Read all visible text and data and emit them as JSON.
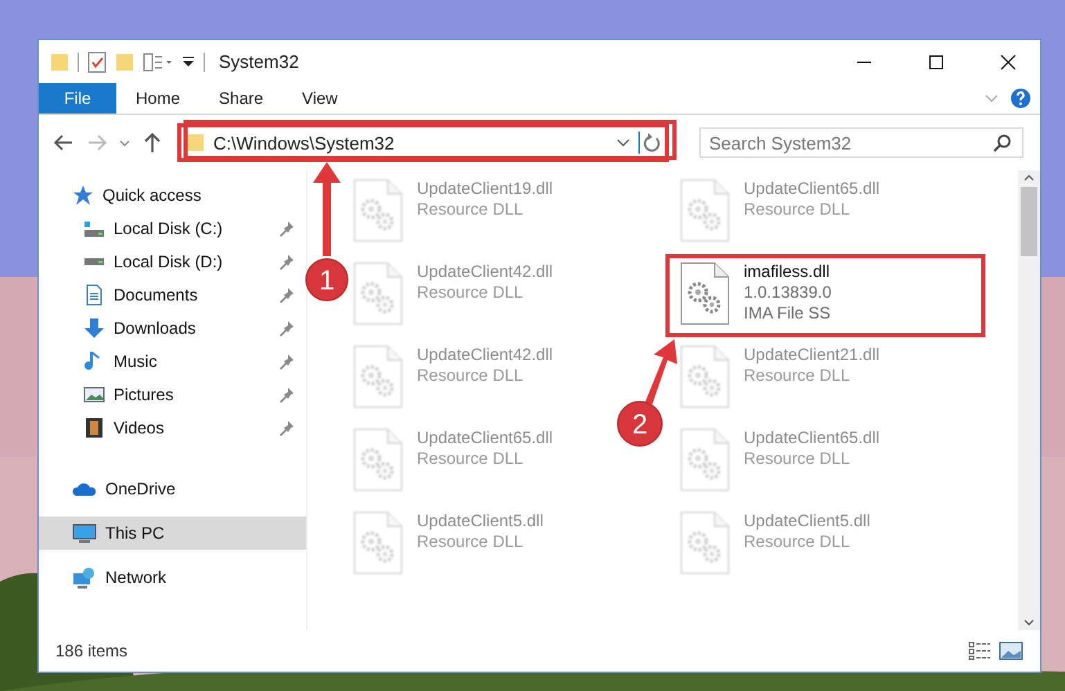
{
  "window": {
    "title": "System32"
  },
  "ribbon_tabs": [
    {
      "label": "File",
      "selected": true
    },
    {
      "label": "Home",
      "selected": false
    },
    {
      "label": "Share",
      "selected": false
    },
    {
      "label": "View",
      "selected": false
    }
  ],
  "address": {
    "path": "C:\\Windows\\System32"
  },
  "search": {
    "placeholder": "Search System32"
  },
  "sidebar": [
    {
      "label": "Quick access",
      "kind": "star",
      "selected": false,
      "children": [
        {
          "label": "Local Disk (C:)",
          "kind": "disk-c",
          "selected": false,
          "pinned": true
        },
        {
          "label": "Local Disk (D:)",
          "kind": "disk",
          "selected": false,
          "pinned": true
        },
        {
          "label": "Documents",
          "kind": "document",
          "selected": false,
          "pinned": true
        },
        {
          "label": "Downloads",
          "kind": "download",
          "selected": false,
          "pinned": true
        },
        {
          "label": "Music",
          "kind": "music",
          "selected": false,
          "pinned": true
        },
        {
          "label": "Pictures",
          "kind": "pictures",
          "selected": false,
          "pinned": true
        },
        {
          "label": "Videos",
          "kind": "film",
          "selected": false,
          "pinned": true
        }
      ]
    },
    {
      "label": "OneDrive",
      "kind": "cloud",
      "selected": false
    },
    {
      "label": "This PC",
      "kind": "monitor",
      "selected": true
    },
    {
      "label": "Network",
      "kind": "network",
      "selected": false
    }
  ],
  "files": [
    {
      "name": "UpdateClient19.dll",
      "lines": [
        "Resource DLL"
      ],
      "blurred": true
    },
    {
      "name": "UpdateClient65.dll",
      "lines": [
        "Resource DLL"
      ],
      "blurred": true
    },
    {
      "name": "UpdateClient42.dll",
      "lines": [
        "Resource DLL"
      ],
      "blurred": true
    },
    {
      "name": "imafiless.dll",
      "lines": [
        "1.0.13839.0",
        "IMA File SS"
      ],
      "blurred": false
    },
    {
      "name": "UpdateClient42.dll",
      "lines": [
        "Resource DLL"
      ],
      "blurred": true
    },
    {
      "name": "UpdateClient21.dll",
      "lines": [
        "Resource DLL"
      ],
      "blurred": true
    },
    {
      "name": "UpdateClient65.dll",
      "lines": [
        "Resource DLL"
      ],
      "blurred": true
    },
    {
      "name": "UpdateClient65.dll",
      "lines": [
        "Resource DLL"
      ],
      "blurred": true
    },
    {
      "name": "UpdateClient5.dll",
      "lines": [
        "Resource DLL"
      ],
      "blurred": true
    },
    {
      "name": "UpdateClient5.dll",
      "lines": [
        "Resource DLL"
      ],
      "blurred": true
    }
  ],
  "status_bar": {
    "count": "186 items"
  },
  "annotations": [
    {
      "label": "1"
    },
    {
      "label": "2"
    }
  ]
}
